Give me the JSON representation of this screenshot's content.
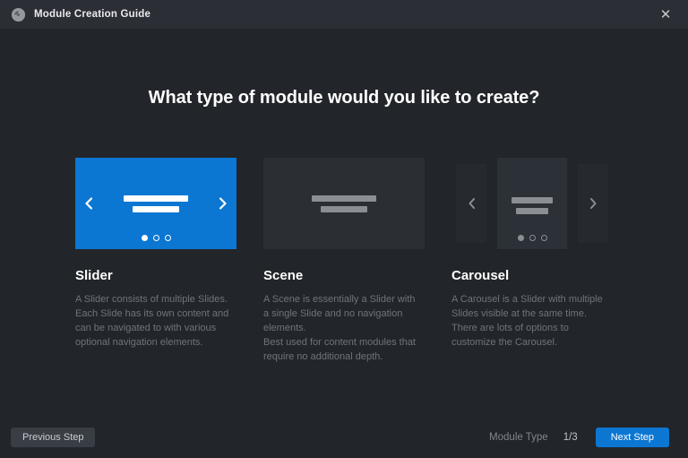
{
  "header": {
    "title": "Module Creation Guide",
    "close_glyph": "✕"
  },
  "heading": "What type of module would you like to create?",
  "options": [
    {
      "id": "slider",
      "title": "Slider",
      "description": "A Slider consists of multiple Slides.\nEach Slide has its own content and can be navigated to with various optional navigation elements.",
      "selected": true
    },
    {
      "id": "scene",
      "title": "Scene",
      "description": "A Scene is essentially a Slider with a single Slide and no navigation elements.\nBest used for content modules that require no additional depth.",
      "selected": false
    },
    {
      "id": "carousel",
      "title": "Carousel",
      "description": "A Carousel is a Slider with multiple Slides visible at the same time.\nThere are lots of options to customize the Carousel.",
      "selected": false
    }
  ],
  "footer": {
    "previous_label": "Previous Step",
    "step_label": "Module Type",
    "step_count": "1/3",
    "next_label": "Next Step"
  },
  "colors": {
    "accent_blue": "#0c77d2",
    "background": "#222529",
    "header_background": "#2b2e34",
    "card_gray": "#2b2e33",
    "bar_gray": "#8b8f94",
    "description_text": "#70747a"
  }
}
